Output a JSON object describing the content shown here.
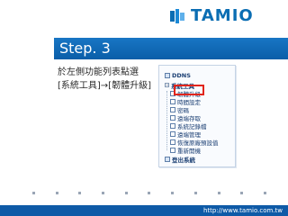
{
  "brand": {
    "logo_text": "TAMIO"
  },
  "slide": {
    "title": "Step. 3",
    "instruction_line1": "於左側功能列表點選",
    "instruction_line2": "[系統工具]→[韌體升級]"
  },
  "tree": {
    "items": [
      {
        "label": "DDNS"
      },
      {
        "label": "系統工具"
      },
      {
        "label": "韌體升級"
      },
      {
        "label": "時間設定"
      },
      {
        "label": "密碼"
      },
      {
        "label": "遠端存取"
      },
      {
        "label": "系統記錄檔"
      },
      {
        "label": "遠端管理"
      },
      {
        "label": "恢復原廠預設值"
      },
      {
        "label": "重新開機"
      },
      {
        "label": "登出系統"
      }
    ]
  },
  "footer": {
    "url": "http://www.tamio.com.tw"
  },
  "colors": {
    "brand_blue": "#0a6db3",
    "footer_blue": "#0e5aa7",
    "highlight_red": "#e1251b"
  }
}
